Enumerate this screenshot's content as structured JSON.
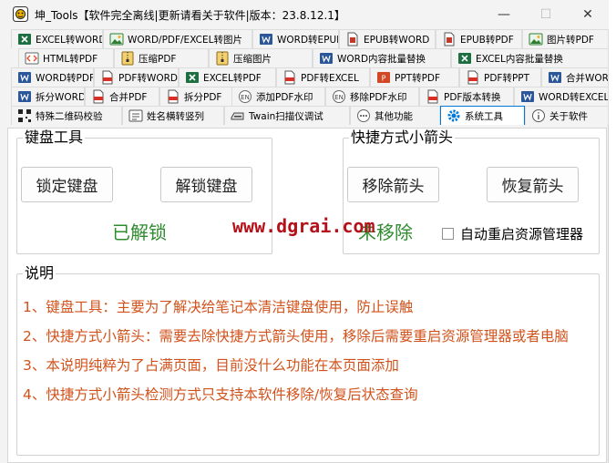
{
  "window": {
    "title": "坤_Tools【软件完全离线|更新请看关于软件|版本：23.8.12.1】",
    "controls": {
      "minimize": "—",
      "maximize": "☐",
      "close": "✕"
    }
  },
  "tabs": [
    {
      "label": "EXCEL转WORD",
      "icon": "excel-icon"
    },
    {
      "label": "WORD/PDF/EXCEL转图片",
      "icon": "image-icon"
    },
    {
      "label": "WORD转EPUB",
      "icon": "word-icon"
    },
    {
      "label": "EPUB转WORD",
      "icon": "epub-icon"
    },
    {
      "label": "EPUB转PDF",
      "icon": "epub-icon"
    },
    {
      "label": "图片转PDF",
      "icon": "image-icon"
    },
    {
      "label": "HTML转PDF",
      "icon": "html-icon"
    },
    {
      "label": "压缩PDF",
      "icon": "compress-icon"
    },
    {
      "label": "压缩图片",
      "icon": "compress-icon"
    },
    {
      "label": "WORD内容批量替换",
      "icon": "word-icon"
    },
    {
      "label": "EXCEL内容批量替换",
      "icon": "excel-icon"
    },
    {
      "label": "WORD转PDF",
      "icon": "word-icon"
    },
    {
      "label": "PDF转WORD",
      "icon": "pdf-icon"
    },
    {
      "label": "EXCEL转PDF",
      "icon": "excel-icon"
    },
    {
      "label": "PDF转EXCEL",
      "icon": "pdf-icon"
    },
    {
      "label": "PPT转PDF",
      "icon": "ppt-icon"
    },
    {
      "label": "PDF转PPT",
      "icon": "pdf-icon"
    },
    {
      "label": "合并WORD",
      "icon": "word-icon"
    },
    {
      "label": "拆分WORD",
      "icon": "word-icon"
    },
    {
      "label": "合并PDF",
      "icon": "pdf-icon"
    },
    {
      "label": "拆分PDF",
      "icon": "pdf-icon"
    },
    {
      "label": "添加PDF水印",
      "icon": "watermark-icon"
    },
    {
      "label": "移除PDF水印",
      "icon": "watermark-icon"
    },
    {
      "label": "PDF版本转换",
      "icon": "pdf-icon"
    },
    {
      "label": "WORD转EXCEL",
      "icon": "word-icon"
    },
    {
      "label": "特殊二维码校验",
      "icon": "qrcode-icon"
    },
    {
      "label": "姓名横转竖列",
      "icon": "name-card-icon"
    },
    {
      "label": "Twain扫描仪调试",
      "icon": "scanner-icon"
    },
    {
      "label": "其他功能",
      "icon": "more-icon"
    },
    {
      "label": "系统工具",
      "icon": "gear-icon"
    },
    {
      "label": "关于软件",
      "icon": "info-icon"
    }
  ],
  "selected_tab": "系统工具",
  "keyboard_group": {
    "title": "键盘工具",
    "lock_button": "锁定键盘",
    "unlock_button": "解锁键盘",
    "status": "已解锁"
  },
  "shortcut_group": {
    "title": "快捷方式小箭头",
    "remove_button": "移除箭头",
    "restore_button": "恢复箭头",
    "status": "未移除",
    "restart_explorer_checkbox": "自动重启资源管理器",
    "restart_explorer_checked": false
  },
  "description": {
    "title": "说明",
    "lines": [
      "1、键盘工具：主要为了解决给笔记本清洁键盘使用，防止误触",
      "2、快捷方式小箭头：需要去除快捷方式箭头使用，移除后需要重启资源管理器或者电脑",
      "3、本说明纯粹为了占满页面，目前没什么功能在本页面添加",
      "4、快捷方式小箭头检测方式只支持本软件移除/恢复后状态查询"
    ]
  },
  "watermark": "www.dgrai.com",
  "colors": {
    "accent": "#0078d7",
    "status_green": "#2e8b2e",
    "note_orange": "#d2521b",
    "watermark_red": "#b3121b"
  }
}
